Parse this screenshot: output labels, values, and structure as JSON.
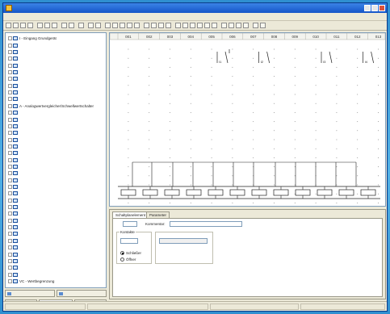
{
  "window": {
    "title": ""
  },
  "menu": [
    "",
    "",
    "",
    "",
    "",
    "",
    "",
    "",
    "",
    "",
    "",
    ""
  ],
  "tree": [
    "I - Eingang Grundgerät",
    "",
    "",
    "",
    "",
    "",
    "",
    "",
    "",
    "",
    "A - Analogwertvergleicher/Schwellwertschalter",
    "",
    "",
    "",
    "",
    "",
    "",
    "",
    "",
    "",
    "",
    "",
    "",
    "",
    "",
    "",
    "",
    "",
    "",
    "",
    "",
    "",
    "",
    "",
    "",
    "",
    "VC - Wertbegrenzung"
  ],
  "left_tabs": {
    "top": [
      "",
      ""
    ],
    "bottom": [
      "",
      "",
      ""
    ]
  },
  "diagram": {
    "columns": [
      "001",
      "002",
      "003",
      "004",
      "005",
      "006",
      "007",
      "008",
      "009",
      "010",
      "011",
      "012",
      "013"
    ],
    "contacts": [
      {
        "label": "I1",
        "col": 5
      },
      {
        "label": "I2",
        "col": 7
      },
      {
        "label": "I3",
        "col": 10
      },
      {
        "label": "I4",
        "col": 12
      }
    ]
  },
  "properties": {
    "tabs": [
      "Schaltplanelement",
      "Parameter"
    ],
    "number_label": "",
    "number_value": "",
    "comment_label": "Kommentar:",
    "comment_value": "",
    "contacts_group": "Kontakte",
    "contacts_value": "",
    "contact_types": [
      "Schließer",
      "Öffner"
    ],
    "second_group": "",
    "second_value": ""
  },
  "status": [
    "",
    "",
    "",
    ""
  ]
}
